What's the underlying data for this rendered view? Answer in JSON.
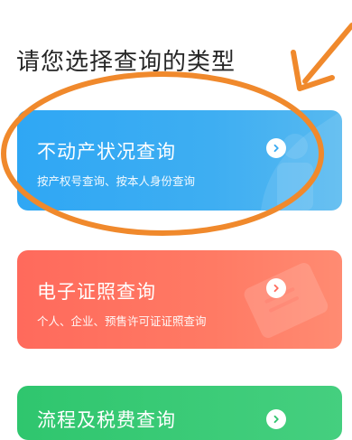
{
  "heading": "请您选择查询的类型",
  "cards": [
    {
      "title": "不动产状况查询",
      "subtitle": "按产权号查询、按本人身份查询"
    },
    {
      "title": "电子证照查询",
      "subtitle": "个人、企业、预售许可证证照查询"
    },
    {
      "title": "流程及税费查询",
      "subtitle": ""
    }
  ],
  "colors": {
    "blue_card": "#2fa7f4",
    "red_card": "#ff6a5c",
    "green_card": "#2fc66e",
    "annotation": "#f0892c"
  },
  "icons": [
    "chevron-right-icon",
    "chevron-right-icon",
    "chevron-right-icon"
  ]
}
